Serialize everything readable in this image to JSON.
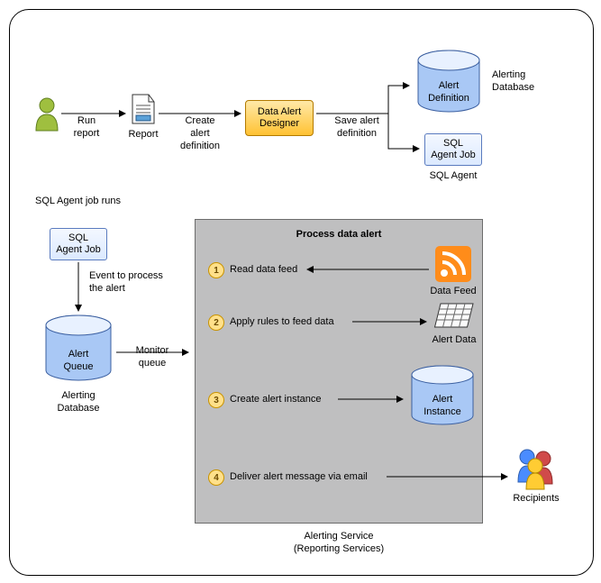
{
  "top": {
    "run_report": "Run\nreport",
    "report": "Report",
    "create_def": "Create\nalert\ndefinition",
    "designer": "Data Alert\nDesigner",
    "save_def": "Save alert\ndefinition",
    "alert_def": "Alert\nDefinition",
    "alerting_db": "Alerting\nDatabase",
    "sql_job": "SQL\nAgent Job",
    "sql_agent": "SQL Agent"
  },
  "mid": {
    "sql_runs": "SQL Agent job runs",
    "sql_job": "SQL\nAgent Job",
    "event_txt": "Event to process\nthe alert",
    "alert_queue": "Alert\nQueue",
    "alerting_db": "Alerting\nDatabase",
    "monitor": "Monitor\nqueue"
  },
  "process": {
    "title": "Process data alert",
    "step1": "Read data feed",
    "step1_lbl": "Data Feed",
    "step2": "Apply rules to feed data",
    "step2_lbl": "Alert Data",
    "step3": "Create alert instance",
    "step3_lbl": "Alert\nInstance",
    "step4": "Deliver alert message via email",
    "recipients": "Recipients",
    "caption": "Alerting Service\n(Reporting Services)",
    "n1": "1",
    "n2": "2",
    "n3": "3",
    "n4": "4"
  }
}
